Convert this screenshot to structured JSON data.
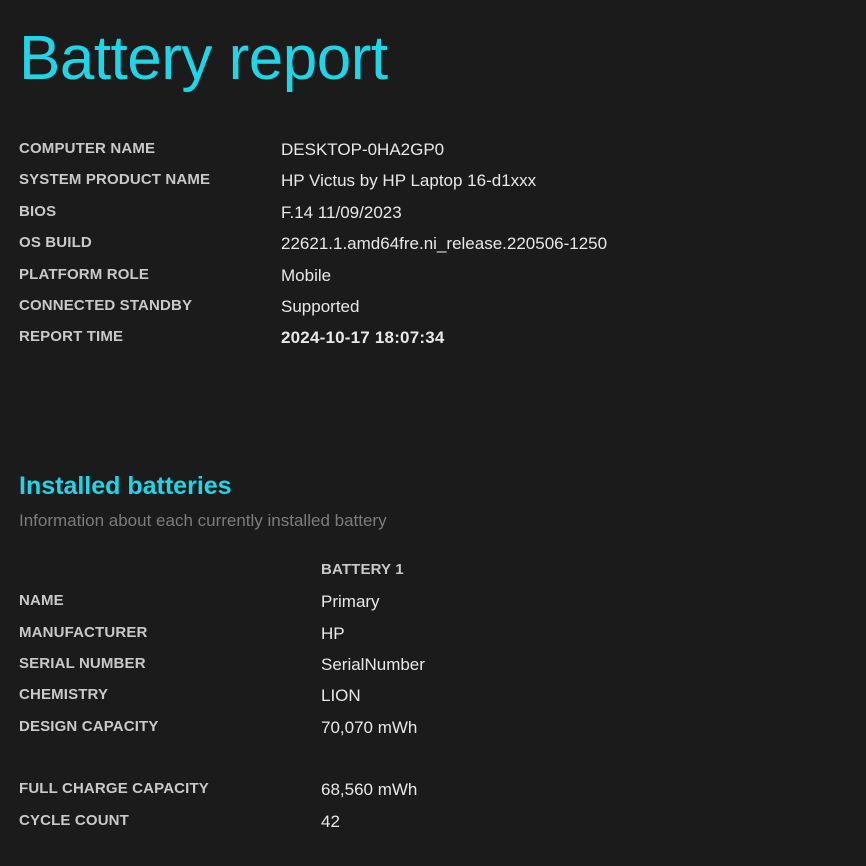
{
  "report": {
    "title": "Battery report"
  },
  "system": {
    "rows": [
      {
        "label": "COMPUTER NAME",
        "value": "DESKTOP-0HA2GP0"
      },
      {
        "label": "SYSTEM PRODUCT NAME",
        "value": "HP Victus by HP Laptop 16-d1xxx"
      },
      {
        "label": "BIOS",
        "value": "F.14 11/09/2023"
      },
      {
        "label": "OS BUILD",
        "value": "22621.1.amd64fre.ni_release.220506-1250"
      },
      {
        "label": "PLATFORM ROLE",
        "value": "Mobile"
      },
      {
        "label": "CONNECTED STANDBY",
        "value": "Supported"
      },
      {
        "label": "REPORT TIME",
        "value": "2024-10-17  18:07:34"
      }
    ]
  },
  "installed_batteries": {
    "title": "Installed batteries",
    "subtitle": "Information about each currently installed battery",
    "column_header": "BATTERY 1",
    "rows": [
      {
        "label": "NAME",
        "value": "Primary"
      },
      {
        "label": "MANUFACTURER",
        "value": "HP"
      },
      {
        "label": "SERIAL NUMBER",
        "value": "SerialNumber"
      },
      {
        "label": "CHEMISTRY",
        "value": "LION"
      },
      {
        "label": "DESIGN CAPACITY",
        "value": "70,070 mWh"
      },
      {
        "label": "FULL CHARGE CAPACITY",
        "value": "68,560 mWh"
      },
      {
        "label": "CYCLE COUNT",
        "value": "42"
      }
    ]
  },
  "colors": {
    "background": "#1b1b1b",
    "accent": "#1fd6e8",
    "label": "#c9c9c9",
    "value": "#e8e8e8",
    "subtitle": "#7c7c7c"
  }
}
